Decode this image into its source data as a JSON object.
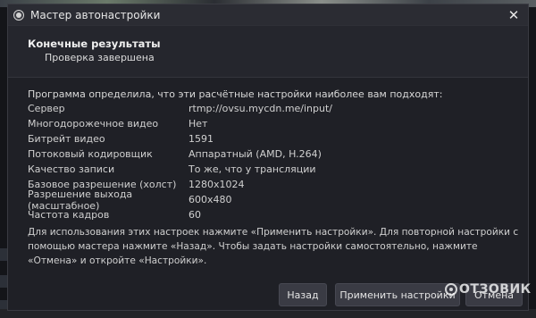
{
  "window": {
    "title": "Мастер автонастройки",
    "close_icon": "close-icon"
  },
  "header": {
    "title": "Конечные результаты",
    "subtitle": "Проверка завершена"
  },
  "intro": "Программа определила, что эти расчётные настройки наиболее вам подходят:",
  "settings": [
    {
      "label": "Сервер",
      "value": "rtmp://ovsu.mycdn.me/input/"
    },
    {
      "label": "Многодорожечное видео",
      "value": "Нет"
    },
    {
      "label": "Битрейт видео",
      "value": "1591"
    },
    {
      "label": "Потоковый кодировщик",
      "value": "Аппаратный (AMD, H.264)"
    },
    {
      "label": "Качество записи",
      "value": "То же, что у трансляции"
    },
    {
      "label": "Базовое разрешение (холст)",
      "value": "1280x1024"
    },
    {
      "label": "Разрешение выхода (масштабное)",
      "value": "600x480"
    },
    {
      "label": "Частота кадров",
      "value": "60"
    }
  ],
  "note": "Для использования этих настроек нажмите «Применить настройки». Для повторной настройки с помощью мастера нажмите «Назад». Чтобы задать настройки самостоятельно, нажмите «Отмена» и откройте «Настройки».",
  "buttons": {
    "back": "Назад",
    "apply": "Применить настройки",
    "cancel": "Отмена"
  },
  "watermark": "ОТЗОВИК"
}
